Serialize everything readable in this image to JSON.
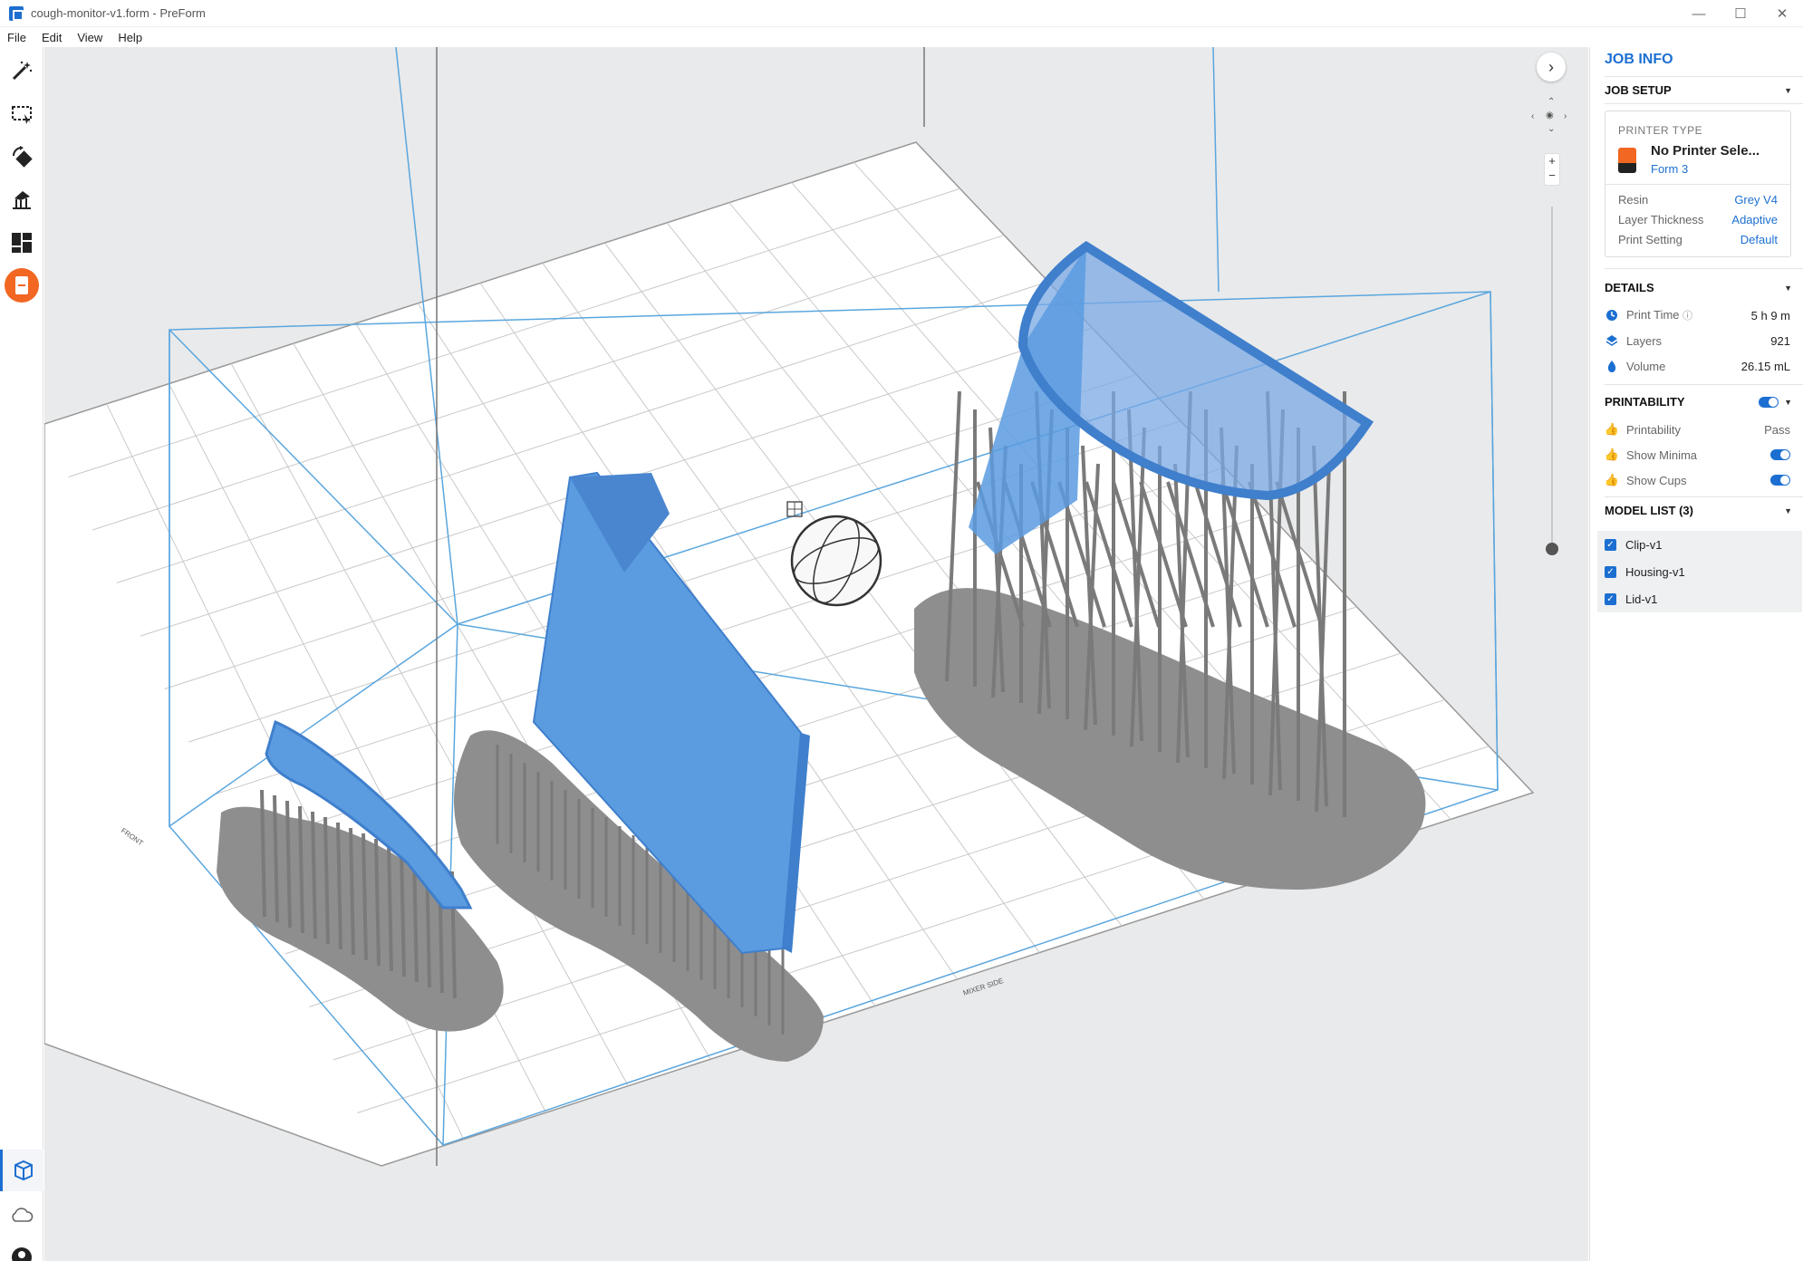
{
  "window": {
    "title": "cough-monitor-v1.form - PreForm",
    "minimize": "—",
    "maximize": "☐",
    "close": "✕"
  },
  "menu": [
    "File",
    "Edit",
    "View",
    "Help"
  ],
  "toolbar": {
    "tools": [
      "magic-wand-icon",
      "select-box-icon",
      "orient-icon",
      "supports-icon",
      "layout-icon",
      "printer-icon"
    ],
    "active_tool": "printer-icon",
    "bottom": [
      "job-view-icon",
      "cloud-icon",
      "account-icon"
    ]
  },
  "viewport": {
    "labels": {
      "front": "FRONT",
      "mixer_side": "MIXER SIDE"
    },
    "colors": {
      "background": "#e9eaeb",
      "model": "#5b9be0",
      "support": "#8e8e8e",
      "build_box": "#5aa6de"
    }
  },
  "panel": {
    "title": "JOB INFO",
    "job_setup": {
      "heading": "JOB SETUP",
      "printer_type_label": "PRINTER TYPE",
      "printer_name": "No Printer Sele...",
      "printer_model": "Form 3",
      "resin_label": "Resin",
      "resin_value": "Grey V4",
      "layer_label": "Layer Thickness",
      "layer_value": "Adaptive",
      "setting_label": "Print Setting",
      "setting_value": "Default"
    },
    "details": {
      "heading": "DETAILS",
      "print_time_label": "Print Time",
      "print_time_value": "5 h 9 m",
      "layers_label": "Layers",
      "layers_value": "921",
      "volume_label": "Volume",
      "volume_value": "26.15 mL"
    },
    "printability": {
      "heading": "PRINTABILITY",
      "printability_label": "Printability",
      "printability_value": "Pass",
      "minima_label": "Show Minima",
      "cups_label": "Show Cups"
    },
    "model_list": {
      "heading": "MODEL LIST (3)",
      "items": [
        "Clip-v1",
        "Housing-v1",
        "Lid-v1"
      ]
    }
  }
}
